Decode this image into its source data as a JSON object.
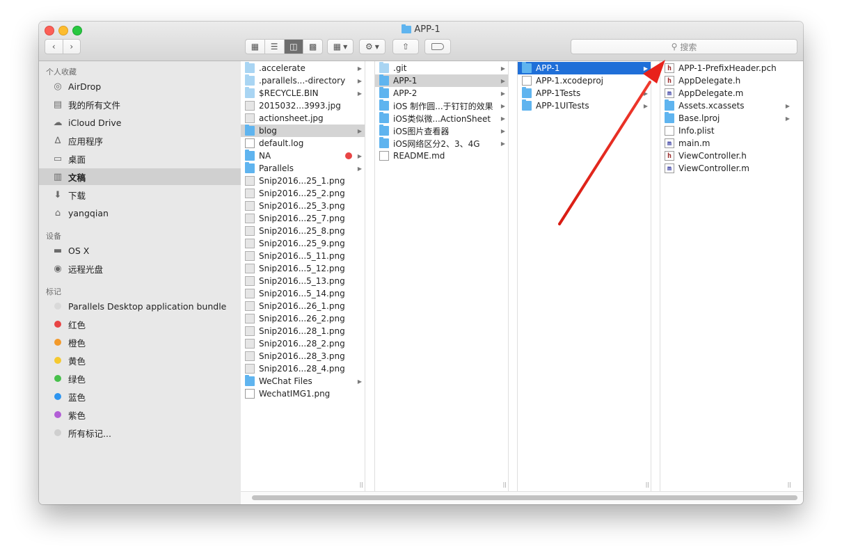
{
  "window": {
    "title": "APP-1"
  },
  "toolbar": {
    "search_placeholder": "搜索",
    "view_modes": [
      "icon-view",
      "list-view",
      "column-view",
      "cover-flow-view"
    ],
    "active_view": "column-view"
  },
  "sidebar": {
    "sections": [
      {
        "title": "个人收藏",
        "items": [
          {
            "label": "AirDrop",
            "icon": "airdrop-icon"
          },
          {
            "label": "我的所有文件",
            "icon": "all-files-icon"
          },
          {
            "label": "iCloud Drive",
            "icon": "cloud-icon"
          },
          {
            "label": "应用程序",
            "icon": "applications-icon"
          },
          {
            "label": "桌面",
            "icon": "desktop-icon"
          },
          {
            "label": "文稿",
            "icon": "documents-icon",
            "selected": true
          },
          {
            "label": "下载",
            "icon": "download-icon"
          },
          {
            "label": "yangqian",
            "icon": "home-icon"
          }
        ]
      },
      {
        "title": "设备",
        "items": [
          {
            "label": "OS X",
            "icon": "hard-disk-icon"
          },
          {
            "label": "远程光盘",
            "icon": "optical-disc-icon"
          }
        ]
      },
      {
        "title": "标记",
        "items": [
          {
            "label": "Parallels Desktop application bundle",
            "color": "#d9d9d9"
          },
          {
            "label": "红色",
            "color": "#e84545"
          },
          {
            "label": "橙色",
            "color": "#f39a2b"
          },
          {
            "label": "黄色",
            "color": "#f5c930"
          },
          {
            "label": "绿色",
            "color": "#47c04b"
          },
          {
            "label": "蓝色",
            "color": "#2e95f0"
          },
          {
            "label": "紫色",
            "color": "#b25fd6"
          },
          {
            "label": "所有标记...",
            "color": "#cfcfcf"
          }
        ]
      }
    ]
  },
  "columns": [
    {
      "items": [
        {
          "name": ".accelerate",
          "type": "folder-pale",
          "chevron": true
        },
        {
          "name": ".parallels...-directory",
          "type": "folder-pale",
          "chevron": true
        },
        {
          "name": "$RECYCLE.BIN",
          "type": "folder-pale",
          "chevron": true
        },
        {
          "name": "2015032...3993.jpg",
          "type": "image"
        },
        {
          "name": "actionsheet.jpg",
          "type": "image"
        },
        {
          "name": "blog",
          "type": "folder",
          "chevron": true,
          "selected": "grey"
        },
        {
          "name": "default.log",
          "type": "doc"
        },
        {
          "name": "NA",
          "type": "folder",
          "chevron": true,
          "tag": "#e84545"
        },
        {
          "name": "Parallels",
          "type": "folder",
          "chevron": true
        },
        {
          "name": "Snip2016...25_1.png",
          "type": "image"
        },
        {
          "name": "Snip2016...25_2.png",
          "type": "image"
        },
        {
          "name": "Snip2016...25_3.png",
          "type": "image"
        },
        {
          "name": "Snip2016...25_7.png",
          "type": "image"
        },
        {
          "name": "Snip2016...25_8.png",
          "type": "image"
        },
        {
          "name": "Snip2016...25_9.png",
          "type": "image"
        },
        {
          "name": "Snip2016...5_11.png",
          "type": "image"
        },
        {
          "name": "Snip2016...5_12.png",
          "type": "image"
        },
        {
          "name": "Snip2016...5_13.png",
          "type": "image"
        },
        {
          "name": "Snip2016...5_14.png",
          "type": "image"
        },
        {
          "name": "Snip2016...26_1.png",
          "type": "image"
        },
        {
          "name": "Snip2016...26_2.png",
          "type": "image"
        },
        {
          "name": "Snip2016...28_1.png",
          "type": "image"
        },
        {
          "name": "Snip2016...28_2.png",
          "type": "image"
        },
        {
          "name": "Snip2016...28_3.png",
          "type": "image"
        },
        {
          "name": "Snip2016...28_4.png",
          "type": "image"
        },
        {
          "name": "WeChat Files",
          "type": "folder",
          "chevron": true
        },
        {
          "name": "WechatIMG1.png",
          "type": "doc"
        }
      ]
    },
    {
      "items": [
        {
          "name": ".git",
          "type": "folder-pale",
          "chevron": true
        },
        {
          "name": "APP-1",
          "type": "folder",
          "chevron": true,
          "selected": "grey"
        },
        {
          "name": "APP-2",
          "type": "folder",
          "chevron": true
        },
        {
          "name": "iOS 制作圆...于钉钉的效果",
          "type": "folder",
          "chevron": true
        },
        {
          "name": "iOS类似微...ActionSheet",
          "type": "folder",
          "chevron": true
        },
        {
          "name": "iOS图片查看器",
          "type": "folder",
          "chevron": true
        },
        {
          "name": "iOS网络区分2、3、4G",
          "type": "folder",
          "chevron": true
        },
        {
          "name": "README.md",
          "type": "doc"
        }
      ]
    },
    {
      "items": [
        {
          "name": "APP-1",
          "type": "folder",
          "chevron": true,
          "selected": "blue"
        },
        {
          "name": "APP-1.xcodeproj",
          "type": "doc"
        },
        {
          "name": "APP-1Tests",
          "type": "folder",
          "chevron": true
        },
        {
          "name": "APP-1UITests",
          "type": "folder",
          "chevron": true
        }
      ]
    },
    {
      "items": [
        {
          "name": "APP-1-PrefixHeader.pch",
          "type": "h"
        },
        {
          "name": "AppDelegate.h",
          "type": "h"
        },
        {
          "name": "AppDelegate.m",
          "type": "m"
        },
        {
          "name": "Assets.xcassets",
          "type": "folder",
          "chevron": true
        },
        {
          "name": "Base.lproj",
          "type": "folder",
          "chevron": true
        },
        {
          "name": "Info.plist",
          "type": "doc"
        },
        {
          "name": "main.m",
          "type": "m"
        },
        {
          "name": "ViewController.h",
          "type": "h"
        },
        {
          "name": "ViewController.m",
          "type": "m"
        }
      ]
    }
  ],
  "annotation": {
    "color": "#e8221b",
    "points_to": "APP-1-PrefixHeader.pch"
  }
}
